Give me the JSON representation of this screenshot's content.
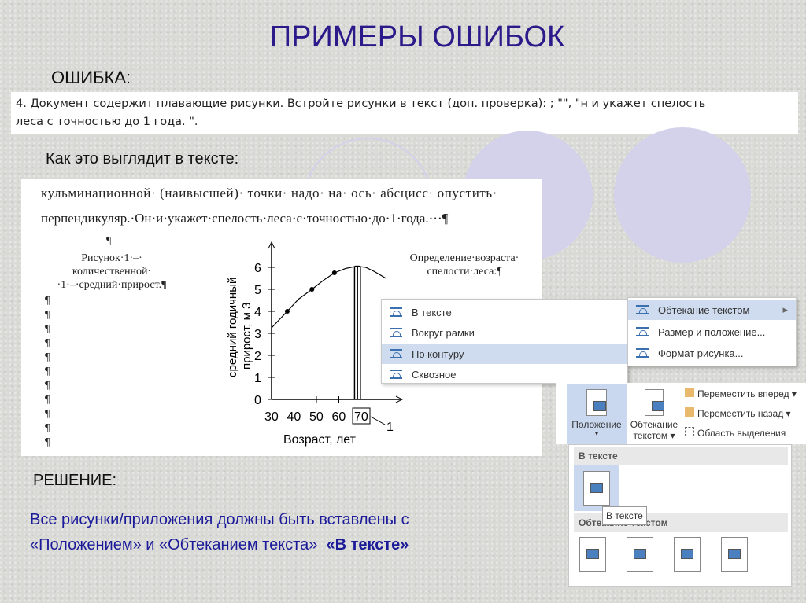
{
  "title": "ПРИМЕРЫ ОШИБОК",
  "error_label": "ОШИБКА:",
  "task_text_1": "4. Документ содержит плавающие рисунки. Встройте рисунки в текст (доп. проверка): ; \"\", \"н и укажет спелость",
  "task_text_2": "леса с точностью до 1 года.   \".",
  "how_label": "Как это выглядит в тексте:",
  "doc": {
    "line1": "кульминационной· (наивысшей)· точки· надо· на· ось· абсцисс· опустить·",
    "line2": "перпендикуляр.·Он·и·укажет·спелость·леса·с·точностью·до·1·года.···¶",
    "pilcrow": "¶",
    "caption_left": [
      "Рисунок·1·–·",
      "количественной·",
      "·1·–·средний·прирост.¶"
    ],
    "caption_right": [
      "Определение·возраста·",
      "спелости·леса:¶"
    ]
  },
  "chart_data": {
    "type": "line",
    "xlabel": "Возраст, лет",
    "ylabel": [
      "средний годичный",
      "прирост, м 3"
    ],
    "x_ticks": [
      "30",
      "40",
      "50",
      "60",
      "70"
    ],
    "x_tick_values": [
      30,
      40,
      50,
      60,
      70
    ],
    "y_ticks": [
      "0",
      "1",
      "2",
      "3",
      "4",
      "5",
      "6"
    ],
    "xlim": [
      30,
      82
    ],
    "ylim": [
      0,
      7
    ],
    "curve": [
      [
        30,
        3.25
      ],
      [
        37,
        4
      ],
      [
        42,
        4.55
      ],
      [
        48,
        5
      ],
      [
        53,
        5.4
      ],
      [
        58,
        5.75
      ],
      [
        63,
        5.95
      ],
      [
        68,
        6.05
      ],
      [
        72,
        6
      ],
      [
        76,
        5.8
      ],
      [
        81,
        5.5
      ]
    ],
    "points": [
      [
        37,
        4
      ],
      [
        48,
        5
      ],
      [
        58,
        5.75
      ]
    ],
    "marker_label": "1",
    "highlight": "70"
  },
  "menu1": {
    "items": [
      "В тексте",
      "Вокруг рамки",
      "По контуру",
      "Сквозное"
    ],
    "selected": 2
  },
  "menu2": {
    "items": [
      "Обтекание текстом",
      "Размер и положение...",
      "Формат рисунка..."
    ],
    "arrow": "▸"
  },
  "ribbon": {
    "position": "Положение",
    "wrap_1": "Обтекание",
    "wrap_2": "текстом ▾",
    "forward": "Переместить вперед",
    "backward": "Переместить назад",
    "selection": "Область выделения"
  },
  "gallery": {
    "in_text": "В тексте",
    "wrap_header": "Обтекание текстом",
    "tooltip": "В тексте"
  },
  "solution_label": "РЕШЕНИЕ:",
  "solution_line1": "Все рисунки/приложения должны быть вставлены с",
  "solution_line2": "«Положением» и «Обтеканием текста»",
  "solution_bold": "«В тексте»"
}
